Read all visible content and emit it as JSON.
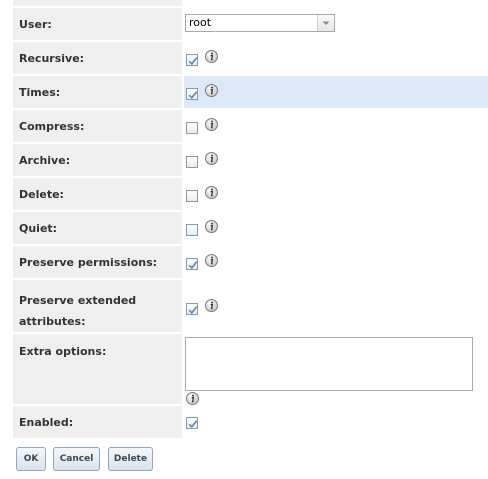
{
  "fields": {
    "user": {
      "label": "User:",
      "value": "root"
    },
    "recursive": {
      "label": "Recursive:",
      "checked": true
    },
    "times": {
      "label": "Times:",
      "checked": true
    },
    "compress": {
      "label": "Compress:",
      "checked": false
    },
    "archive": {
      "label": "Archive:",
      "checked": false
    },
    "delete": {
      "label": "Delete:",
      "checked": false
    },
    "quiet": {
      "label": "Quiet:",
      "checked": false
    },
    "preserve_permissions": {
      "label": "Preserve permissions:",
      "checked": true
    },
    "preserve_extended_attributes": {
      "label_line1": "Preserve extended",
      "label_line2": "attributes:",
      "checked": true
    },
    "extra_options": {
      "label": "Extra options:",
      "value": ""
    },
    "enabled": {
      "label": "Enabled:",
      "checked": true
    }
  },
  "buttons": {
    "ok": "OK",
    "cancel": "Cancel",
    "delete": "Delete"
  },
  "colors": {
    "label_background": "#efefef",
    "highlight_row": "#dde9f7",
    "checkmark": "#5c87b2"
  }
}
